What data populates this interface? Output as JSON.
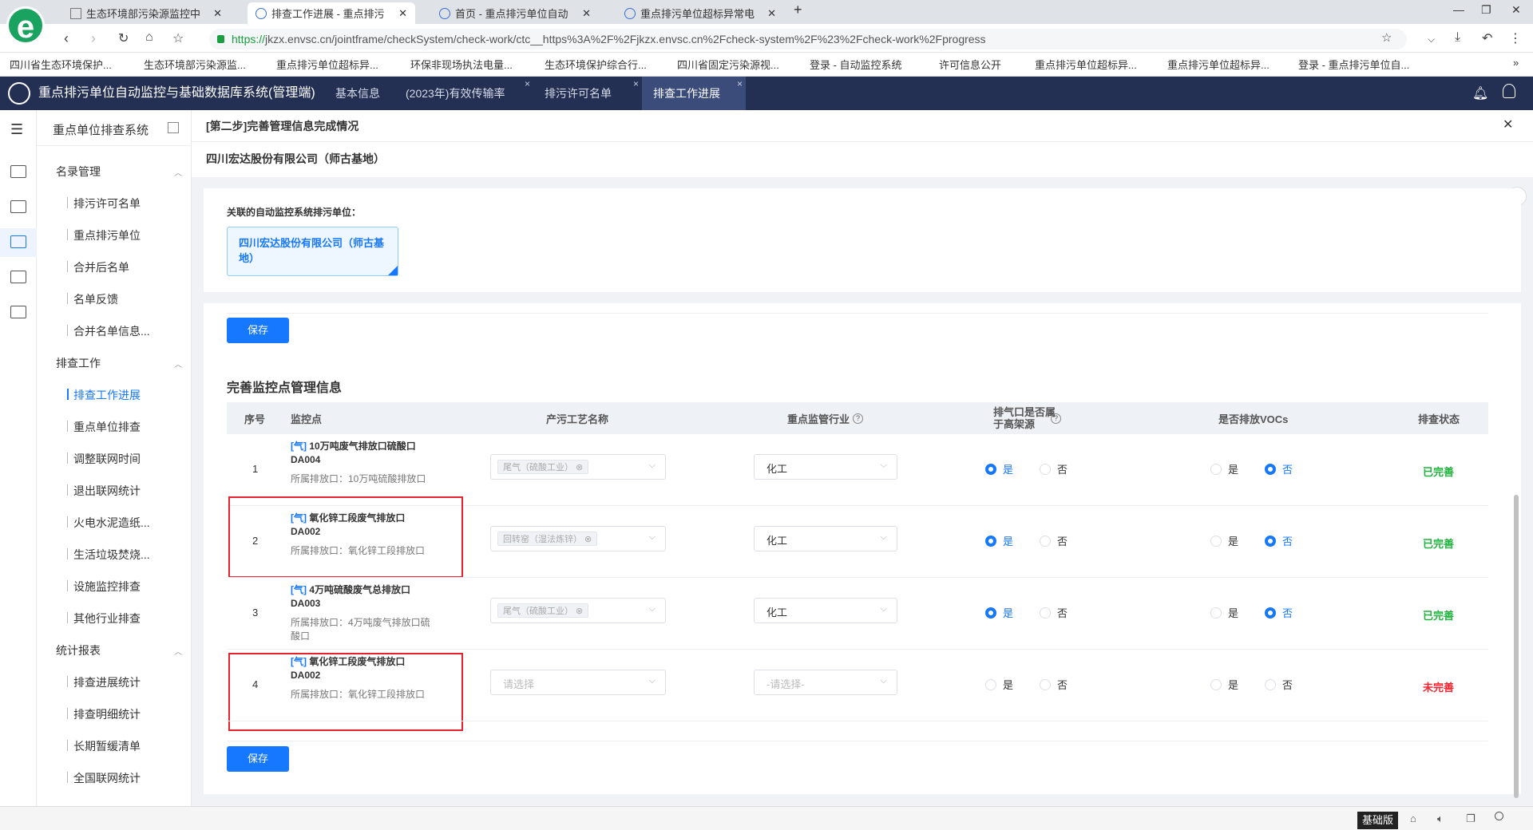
{
  "browser": {
    "tabs": [
      {
        "label": "生态环境部污染源监控中"
      },
      {
        "label": "排查工作进展 - 重点排污"
      },
      {
        "label": "首页 - 重点排污单位自动"
      },
      {
        "label": "重点排污单位超标异常电"
      }
    ],
    "url_proto": "https://",
    "url_rest": "jkzx.envsc.cn/jointframe/checkSystem/check-work/ctc__https%3A%2F%2Fjkzx.envsc.cn%2Fcheck-system%2F%23%2Fcheck-work%2Fprogress",
    "bookmarks": [
      "四川省生态环境保护...",
      "生态环境部污染源监...",
      "重点排污单位超标异...",
      "环保非现场执法电量...",
      "生态环境保护综合行...",
      "四川省固定污染源视...",
      "登录 - 自动监控系统",
      "许可信息公开",
      "重点排污单位超标异...",
      "重点排污单位超标异...",
      "登录 - 重点排污单位自..."
    ]
  },
  "app": {
    "title": "重点排污单位自动监控与基础数据库系统(管理端)",
    "tabs": [
      "基本信息",
      "(2023年)有效传输率",
      "排污许可名单",
      "排查工作进展"
    ]
  },
  "sidebar": {
    "title": "重点单位排查系统",
    "groups": [
      {
        "label": "名录管理",
        "items": [
          "排污许可名单",
          "重点排污单位",
          "合并后名单",
          "名单反馈",
          "合并名单信息..."
        ]
      },
      {
        "label": "排查工作",
        "items": [
          "排查工作进展",
          "重点单位排查",
          "调整联网时间",
          "退出联网统计",
          "火电水泥造纸...",
          "生活垃圾焚烧...",
          "设施监控排查",
          "其他行业排查"
        ]
      },
      {
        "label": "统计报表",
        "items": [
          "排查进展统计",
          "排查明细统计",
          "长期暂缓清单",
          "全国联网统计"
        ]
      }
    ]
  },
  "main": {
    "step_title": "[第二步]完善管理信息完成情况",
    "company": "四川宏达股份有限公司（师古基地）",
    "linked_label": "关联的自动监控系统排污单位：",
    "linked_unit": "四川宏达股份有限公司（师古基地）",
    "save_label": "保存",
    "section_title": "完善监控点管理信息",
    "columns": [
      "序号",
      "监控点",
      "产污工艺名称",
      "重点监管行业",
      "排气口是否属于高架源",
      "是否排放VOCs",
      "排查状态"
    ],
    "yes": "是",
    "no": "否",
    "rows": [
      {
        "no": "1",
        "prefix": "[气]",
        "name": "10万吨废气排放口硫酸口DA004",
        "outlet": "所属排放口：10万吨硫酸排放口",
        "process": "尾气（硫酸工业）",
        "industry": "化工",
        "high": "yes",
        "vocs": "no",
        "status": "已完善"
      },
      {
        "no": "2",
        "prefix": "[气]",
        "name": "氧化锌工段废气排放口DA002",
        "outlet": "所属排放口：氧化锌工段排放口",
        "process": "回转窑（湿法炼锌）",
        "industry": "化工",
        "high": "yes",
        "vocs": "no",
        "status": "已完善"
      },
      {
        "no": "3",
        "prefix": "[气]",
        "name": "4万吨硫酸废气总排放口DA003",
        "outlet": "所属排放口：4万吨废气排放口硫酸口",
        "process": "尾气（硫酸工业）",
        "industry": "化工",
        "high": "yes",
        "vocs": "no",
        "status": "已完善"
      },
      {
        "no": "4",
        "prefix": "[气]",
        "name": "氧化锌工段废气排放口DA002",
        "outlet": "所属排放口：氧化锌工段排放口",
        "process_placeholder": "请选择",
        "industry_placeholder": "-请选择-",
        "high": "none",
        "vocs": "none",
        "status": "未完善"
      }
    ]
  },
  "statusbar": {
    "label": "基础版"
  },
  "colors": {
    "primary": "#1677ff",
    "header": "#232f53",
    "done": "#1fb33d",
    "undone": "#f5222d",
    "highlight": "#e8212f"
  }
}
